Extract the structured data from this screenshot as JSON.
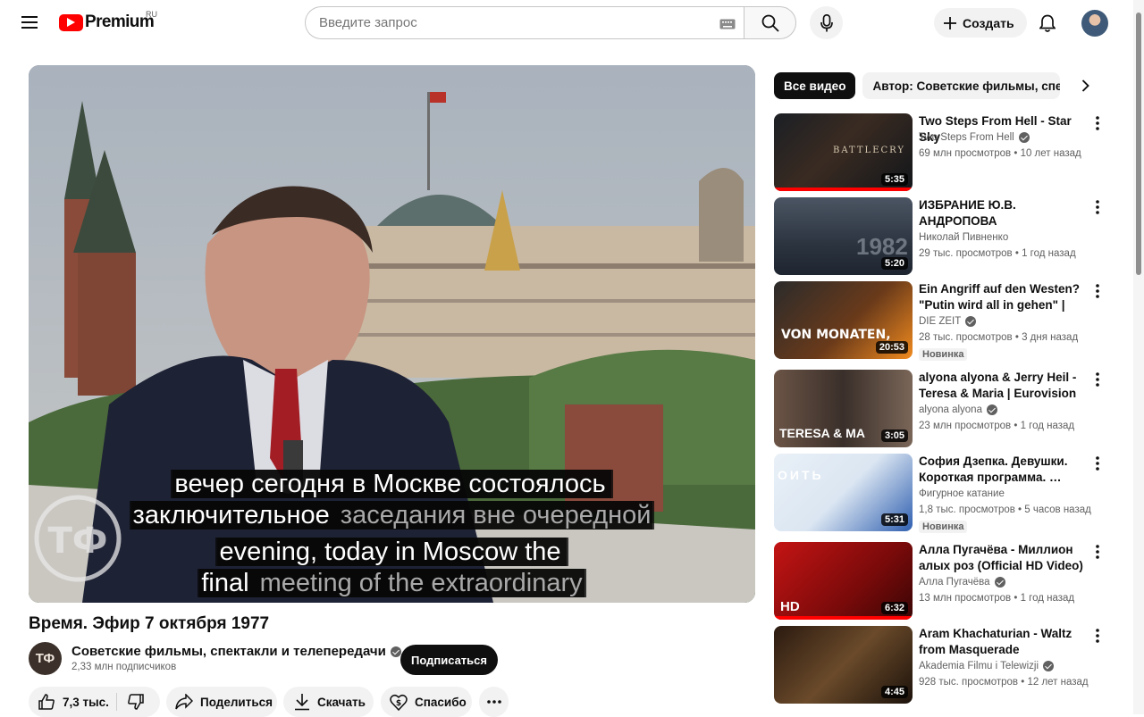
{
  "header": {
    "logo_text": "Premium",
    "country": "RU",
    "search_placeholder": "Введите запрос",
    "create_label": "Создать"
  },
  "video": {
    "captions": [
      {
        "bright": "вечер сегодня в Москве состоялось",
        "dim": ""
      },
      {
        "bright": "заключительное",
        "dim": " заседания вне очередной"
      },
      {
        "bright": "evening, today in Moscow the",
        "dim": ""
      },
      {
        "bright": "final",
        "dim": " meeting of the extraordinary"
      }
    ],
    "title": "Время. Эфир 7 октября 1977",
    "channel": {
      "name": "Советские фильмы, спектакли и телепередачи",
      "subscribers": "2,33 млн подписчиков",
      "avatar_text": "ТФ"
    },
    "subscribe_label": "Подписаться",
    "actions": {
      "likes": "7,3 тыс.",
      "share": "Поделиться",
      "download": "Скачать",
      "thanks": "Спасибо"
    }
  },
  "sidebar": {
    "chips": [
      "Все видео",
      "Автор: Советские фильмы, спектакли и телепередачи"
    ],
    "recommendations": [
      {
        "title": "Two Steps From Hell - Star Sky",
        "channel": "Two Steps From Hell",
        "verified": true,
        "views": "69 млн просмотров",
        "age": "10 лет назад",
        "duration": "5:35",
        "badge": "",
        "thumb_text": "BATTLECRY",
        "progress": 1.0
      },
      {
        "title": "ИЗБРАНИЕ Ю.В. АНДРОПОВА ГЕНЕРАЛЬНЫМ СЕКРЕТАРЕ…",
        "channel": "Николай Пивненко",
        "verified": false,
        "views": "29 тыс. просмотров",
        "age": "1 год назад",
        "duration": "5:20",
        "badge": "",
        "thumb_text": "1982",
        "progress": 0
      },
      {
        "title": "Ein Angriff auf den Westen? \"Putin wird all in gehen\" | DAS …",
        "channel": "DIE ZEIT",
        "verified": true,
        "views": "28 тыс. просмотров",
        "age": "3 дня назад",
        "duration": "20:53",
        "badge": "Новинка",
        "thumb_text": "VON MONATEN,",
        "progress": 0
      },
      {
        "title": "alyona alyona & Jerry Heil - Teresa & Maria | Eurovision …",
        "channel": "alyona alyona",
        "verified": true,
        "views": "23 млн просмотров",
        "age": "1 год назад",
        "duration": "3:05",
        "badge": "",
        "thumb_text": "TERESA & MA",
        "progress": 0
      },
      {
        "title": "София Дзепка. Девушки. Короткая программа. …",
        "channel": "Фигурное катание",
        "verified": false,
        "views": "1,8 тыс. просмотров",
        "age": "5 часов назад",
        "duration": "5:31",
        "badge": "Новинка",
        "thumb_text": "ОИТЬ",
        "progress": 0
      },
      {
        "title": "Алла Пугачёва - Миллион алых роз (Official HD Video) …",
        "channel": "Алла Пугачёва",
        "verified": true,
        "views": "13 млн просмотров",
        "age": "1 год назад",
        "duration": "6:32",
        "badge": "",
        "thumb_text": "HD",
        "progress": 1.0
      },
      {
        "title": "Aram Khachaturian - Waltz from Masquerade",
        "channel": "Akademia Filmu i Telewizji",
        "verified": true,
        "views": "928 тыс. просмотров",
        "age": "12 лет назад",
        "duration": "4:45",
        "badge": "",
        "thumb_text": "",
        "progress": 0
      }
    ]
  },
  "colors": {
    "accent": "#ff0000",
    "text": "#0f0f0f",
    "secondary": "#606060",
    "chip_bg": "#f2f2f2"
  }
}
